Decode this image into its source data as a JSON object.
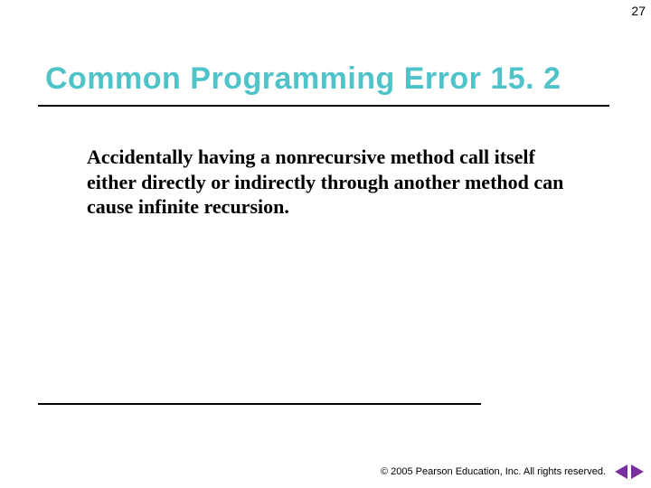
{
  "page_number": "27",
  "title": "Common Programming Error 15. 2",
  "body": "Accidentally having a nonrecursive method call itself either directly or indirectly through another method can cause infinite recursion.",
  "footer": {
    "copyright_symbol": "©",
    "text": " 2005 Pearson Education, Inc.  All rights reserved."
  },
  "icons": {
    "prev": "previous-slide-icon",
    "next": "next-slide-icon"
  },
  "colors": {
    "title": "#4ec3c9",
    "arrow": "#7a2fa0"
  }
}
